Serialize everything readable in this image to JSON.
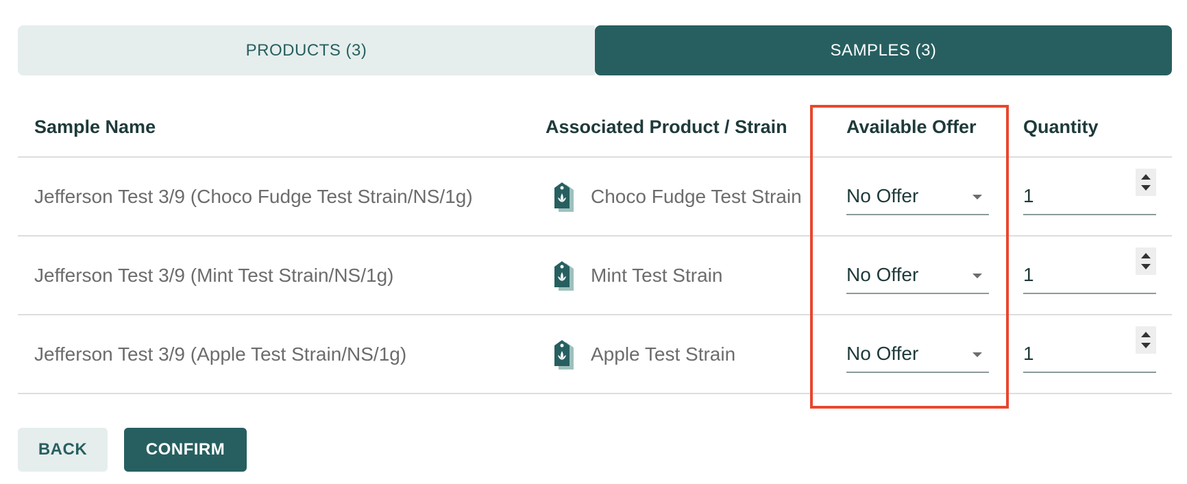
{
  "tabs": [
    {
      "label": "PRODUCTS (3)",
      "active": false
    },
    {
      "label": "SAMPLES (3)",
      "active": true
    }
  ],
  "table": {
    "headers": {
      "sample_name": "Sample Name",
      "associated": "Associated Product / Strain",
      "offer": "Available Offer",
      "quantity": "Quantity"
    },
    "rows": [
      {
        "sample_name": "Jefferson Test 3/9 (Choco Fudge Test Strain/NS/1g)",
        "product": "Choco Fudge Test Strain",
        "offer": "No Offer",
        "quantity": "1"
      },
      {
        "sample_name": "Jefferson Test 3/9 (Mint Test Strain/NS/1g)",
        "product": "Mint Test Strain",
        "offer": "No Offer",
        "quantity": "1"
      },
      {
        "sample_name": "Jefferson Test 3/9 (Apple Test Strain/NS/1g)",
        "product": "Apple Test Strain",
        "offer": "No Offer",
        "quantity": "1"
      }
    ]
  },
  "buttons": {
    "back": "BACK",
    "confirm": "CONFIRM"
  },
  "icons": {
    "product_tag": "product-tag-icon",
    "dropdown": "chevron-down-icon",
    "stepper": "number-stepper-icon"
  },
  "colors": {
    "brand": "#275f60",
    "brand_light": "#e5eeec",
    "highlight": "#e8472e"
  }
}
